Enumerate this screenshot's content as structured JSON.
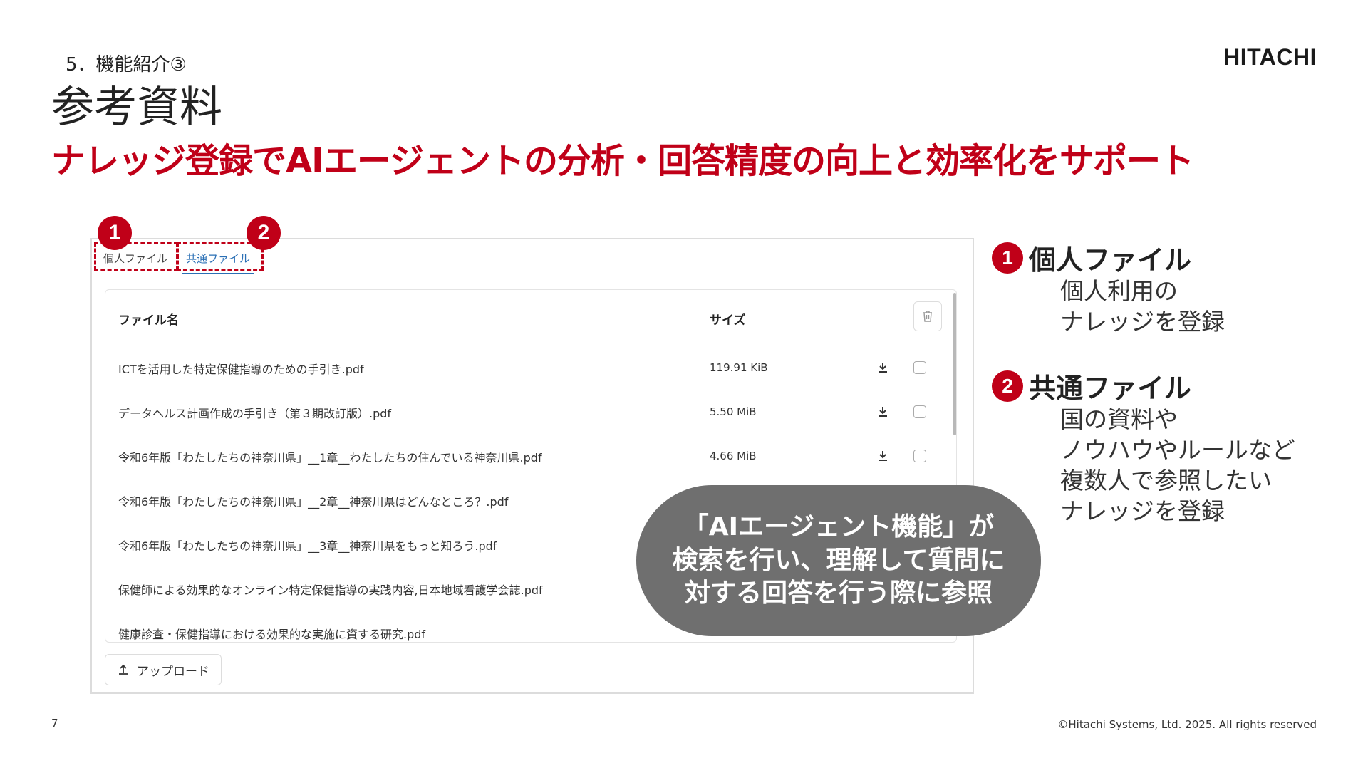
{
  "slide": {
    "section_label": "5．機能紹介③",
    "title": "参考資料",
    "headline": "ナレッジ登録でAIエージェントの分析・回答精度の向上と効率化をサポート",
    "logo_text": "HITACHI",
    "page_number": "7",
    "copyright": "©Hitachi Systems, Ltd. 2025. All rights reserved",
    "accent_color": "#c00018"
  },
  "ui": {
    "tabs": [
      {
        "label": "個人ファイル",
        "active": false
      },
      {
        "label": "共通ファイル",
        "active": true
      }
    ],
    "columns": {
      "name": "ファイル名",
      "size": "サイズ"
    },
    "files": [
      {
        "name": "ICTを活用した特定保健指導のための手引き.pdf",
        "size": "119.91 KiB"
      },
      {
        "name": "データヘルス計画作成の手引き（第３期改訂版）.pdf",
        "size": "5.50 MiB"
      },
      {
        "name": "令和6年版「わたしたちの神奈川県」__1章__わたしたちの住んでいる神奈川県.pdf",
        "size": "4.66 MiB"
      },
      {
        "name": "令和6年版「わたしたちの神奈川県」__2章__神奈川県はどんなところ？.pdf",
        "size": ""
      },
      {
        "name": "令和6年版「わたしたちの神奈川県」__3章__神奈川県をもっと知ろう.pdf",
        "size": ""
      },
      {
        "name": "保健師による効果的なオンライン特定保健指導の実践内容,日本地域看護学会誌.pdf",
        "size": ""
      },
      {
        "name": "健康診査・保健指導における効果的な実施に資する研究.pdf",
        "size": ""
      }
    ],
    "upload_label": "アップロード"
  },
  "markers": [
    "1",
    "2"
  ],
  "bubble": {
    "line1": "「AIエージェント機能」が",
    "line2": "検索を行い、理解して質問に",
    "line3": "対する回答を行う際に参照"
  },
  "legend": [
    {
      "num": "1",
      "title": "個人ファイル",
      "lines": [
        "個人利用の",
        "ナレッジを登録"
      ]
    },
    {
      "num": "2",
      "title": "共通ファイル",
      "lines": [
        "国の資料や",
        "ノウハウやルールなど",
        "複数人で参照したい",
        "ナレッジを登録"
      ]
    }
  ]
}
